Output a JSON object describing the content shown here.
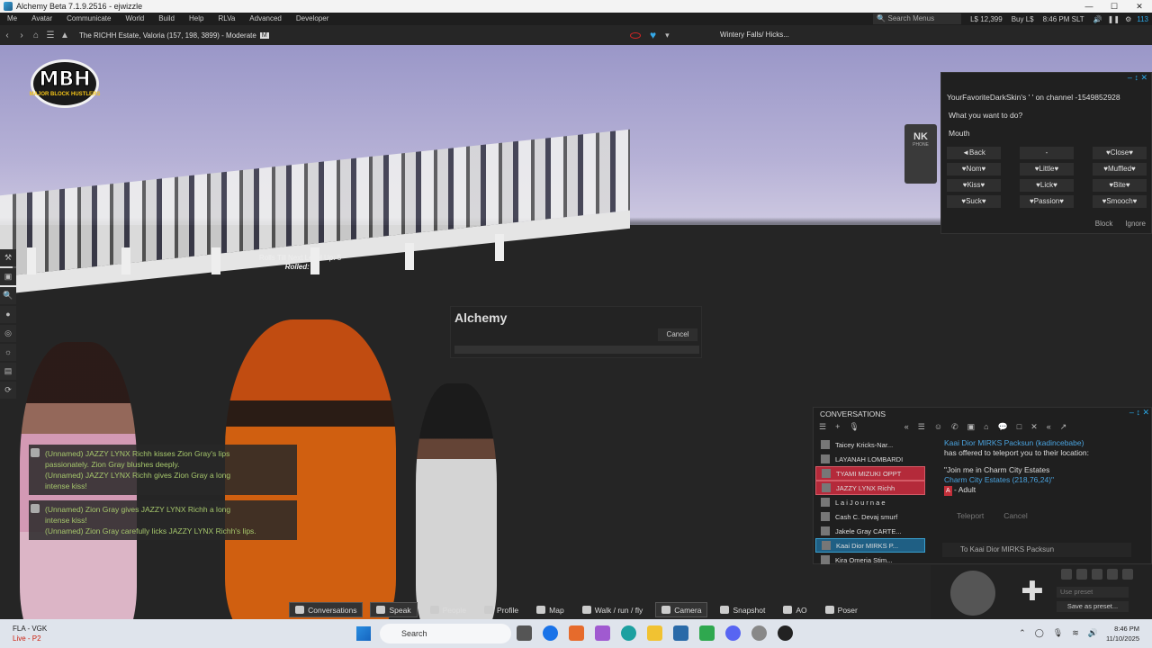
{
  "window": {
    "title": "Alchemy Beta 7.1.9.2516 - ejwizzle",
    "controls": [
      "—",
      "☐",
      "✕"
    ]
  },
  "menu": {
    "items": [
      "Me",
      "Avatar",
      "Communicate",
      "World",
      "Build",
      "Help",
      "RLVa",
      "Advanced",
      "Developer"
    ],
    "search_placeholder": "Search Menus",
    "balance": "L$ 12,399",
    "buy": "Buy L$",
    "time": "8:46 PM SLT",
    "fps": "113"
  },
  "nav": {
    "location": "The RICHH Estate, Valoria (157, 198, 3899) - Moderate",
    "maturity_badge": "M",
    "music": "Wintery Falls/ Hicks..."
  },
  "logo": {
    "text": "MBH",
    "subtitle": "MAJOR BLOCK HUSTLERS"
  },
  "scene": {
    "float_line1": "Rolls Till Next Level Up: 5",
    "float_line2": "Rolled: 5"
  },
  "nk_phone": {
    "brand": "NK",
    "label": "PHONE"
  },
  "dialog": {
    "from": "YourFavoriteDarkSkin's ' ' on channel -1549852928",
    "question": "What you want to do?",
    "menu_label": "Mouth",
    "buttons": [
      "◄Back",
      "-",
      "♥Close♥",
      "♥Nom♥",
      "♥Little♥",
      "♥Muffled♥",
      "♥Kiss♥",
      "♥Lick♥",
      "♥Bite♥",
      "♥Suck♥",
      "♥Passion♥",
      "♥Smooch♥"
    ],
    "block": "Block",
    "ignore": "Ignore"
  },
  "alchemy_progress": {
    "title": "Alchemy",
    "cancel": "Cancel"
  },
  "chat": {
    "block1": [
      "(Unnamed) JAZZY LYNX Richh kisses Zion Gray's lips",
      "passionately. Zion Gray blushes deeply.",
      "(Unnamed) JAZZY LYNX Richh gives Zion Gray a long",
      "intense kiss!"
    ],
    "block2": [
      "(Unnamed) Zion Gray gives JAZZY LYNX Richh a long",
      "intense kiss!",
      "(Unnamed) Zion Gray carefully licks JAZZY LYNX Richh's lips."
    ]
  },
  "conversations": {
    "title": "CONVERSATIONS",
    "contacts": [
      {
        "name": "Taicey Kricks-Nar...",
        "state": "normal"
      },
      {
        "name": "LAYANAH LOMBARDI",
        "state": "normal"
      },
      {
        "name": "TYAMI MIZUKI OPPT",
        "state": "red"
      },
      {
        "name": "JAZZY LYNX Richh",
        "state": "red"
      },
      {
        "name": "L a i J o u r n a e",
        "state": "normal"
      },
      {
        "name": "Cash C. Devaj smurf",
        "state": "normal"
      },
      {
        "name": "Jakele Gray CARTE...",
        "state": "normal"
      },
      {
        "name": "Kaai Dior MIRKS P...",
        "state": "selected"
      },
      {
        "name": "Kira Omeria Stim...",
        "state": "normal"
      }
    ],
    "message": {
      "sender": "Kaai Dior MIRKS Packsun (kadincebabe)",
      "line1": "has offered to teleport you to their location:",
      "quote": "\"Join me in Charm City Estates",
      "place": "Charm City Estates (218,76,24)\"",
      "rating": "Adult",
      "rating_badge": "A",
      "teleport": "Teleport",
      "cancel": "Cancel"
    },
    "input_placeholder": "To Kaai Dior MIRKS Packsun"
  },
  "movement": {
    "preset_placeholder": "Use preset",
    "save_preset": "Save as preset..."
  },
  "bottom_toolbar": [
    {
      "label": "Conversations",
      "active": true
    },
    {
      "label": "Speak",
      "active": true
    },
    {
      "label": "People",
      "active": false
    },
    {
      "label": "Profile",
      "active": false
    },
    {
      "label": "Map",
      "active": false
    },
    {
      "label": "Walk / run / fly",
      "active": false
    },
    {
      "label": "Camera",
      "active": true
    },
    {
      "label": "Snapshot",
      "active": false
    },
    {
      "label": "AO",
      "active": false
    },
    {
      "label": "Poser",
      "active": false
    }
  ],
  "taskbar": {
    "weather_title": "FLA - VGK",
    "weather_sub": "Live - P2",
    "search_label": "Search",
    "time": "8:46 PM",
    "date": "11/10/2025"
  },
  "colors": {
    "accent": "#2aa7e6",
    "chat_text": "#a6c76c",
    "alert_red": "#b42a3a",
    "selected_blue": "#1f5f84"
  }
}
